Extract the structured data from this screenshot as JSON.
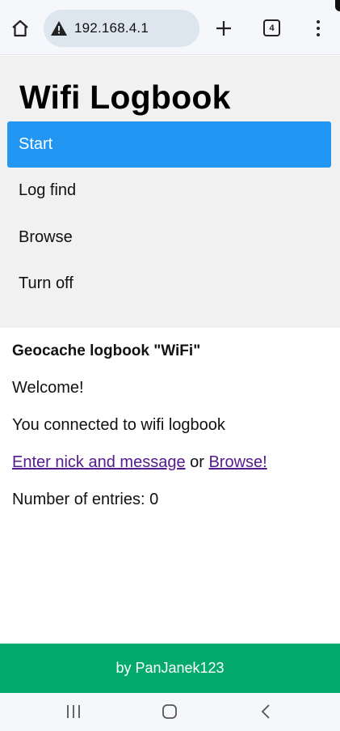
{
  "browser": {
    "url": "192.168.4.1",
    "tab_count": "4"
  },
  "site": {
    "title": "Wifi Logbook",
    "nav": [
      {
        "label": "Start",
        "active": true
      },
      {
        "label": "Log find",
        "active": false
      },
      {
        "label": "Browse",
        "active": false
      },
      {
        "label": "Turn off",
        "active": false
      }
    ]
  },
  "main": {
    "heading": "Geocache logbook \"WiFi\"",
    "welcome": "Welcome!",
    "connected": "You connected to wifi logbook",
    "link_enter": "Enter nick and message",
    "or_text": " or ",
    "link_browse": "Browse!",
    "entries": "Number of entries: 0"
  },
  "footer": {
    "text": "by PanJanek123"
  },
  "colors": {
    "accent": "#2196F3",
    "footer": "#04AA6D",
    "nav_bg": "#f1f1f1"
  }
}
